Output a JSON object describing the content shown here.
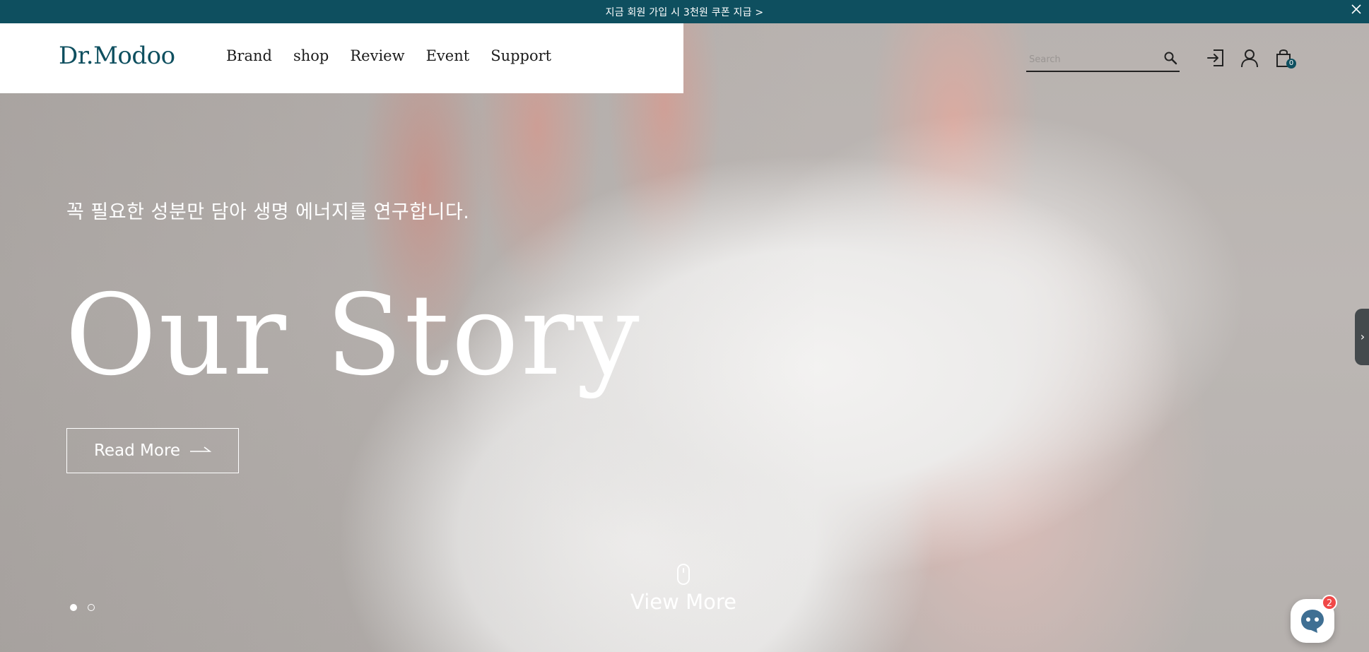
{
  "promo_bar": {
    "text": "지금 회원 가입 시 3천원 쿠폰 지급 >",
    "close_icon": "close-icon"
  },
  "header": {
    "logo": "Dr.Modoo",
    "nav": [
      {
        "label": "Brand"
      },
      {
        "label": "shop"
      },
      {
        "label": "Review"
      },
      {
        "label": "Event"
      },
      {
        "label": "Support"
      }
    ],
    "search": {
      "placeholder": "Search",
      "value": "",
      "icon": "search-icon"
    },
    "icons": {
      "login": "login-icon",
      "account": "user-icon",
      "cart": "shopping-bag-icon"
    },
    "cart_count": "0"
  },
  "hero": {
    "subtitle": "꼭 필요한 성분만 담아 생명 에너지를 연구합니다.",
    "title": "Our Story",
    "cta_label": "Read More",
    "cta_icon": "arrow-right-icon",
    "slides": [
      {
        "active": true
      },
      {
        "active": false
      }
    ],
    "view_more_label": "View More",
    "view_more_icon": "mouse-scroll-icon"
  },
  "side_tab": {
    "icon": "chevron-right-icon",
    "glyph": "›"
  },
  "chat": {
    "icon": "chat-bot-icon",
    "badge": "2"
  },
  "colors": {
    "brand": "#0e4f5f",
    "promo_bg": "#0e4f5f",
    "badge_red": "#f04848",
    "side_tab_bg": "#444a4d"
  }
}
